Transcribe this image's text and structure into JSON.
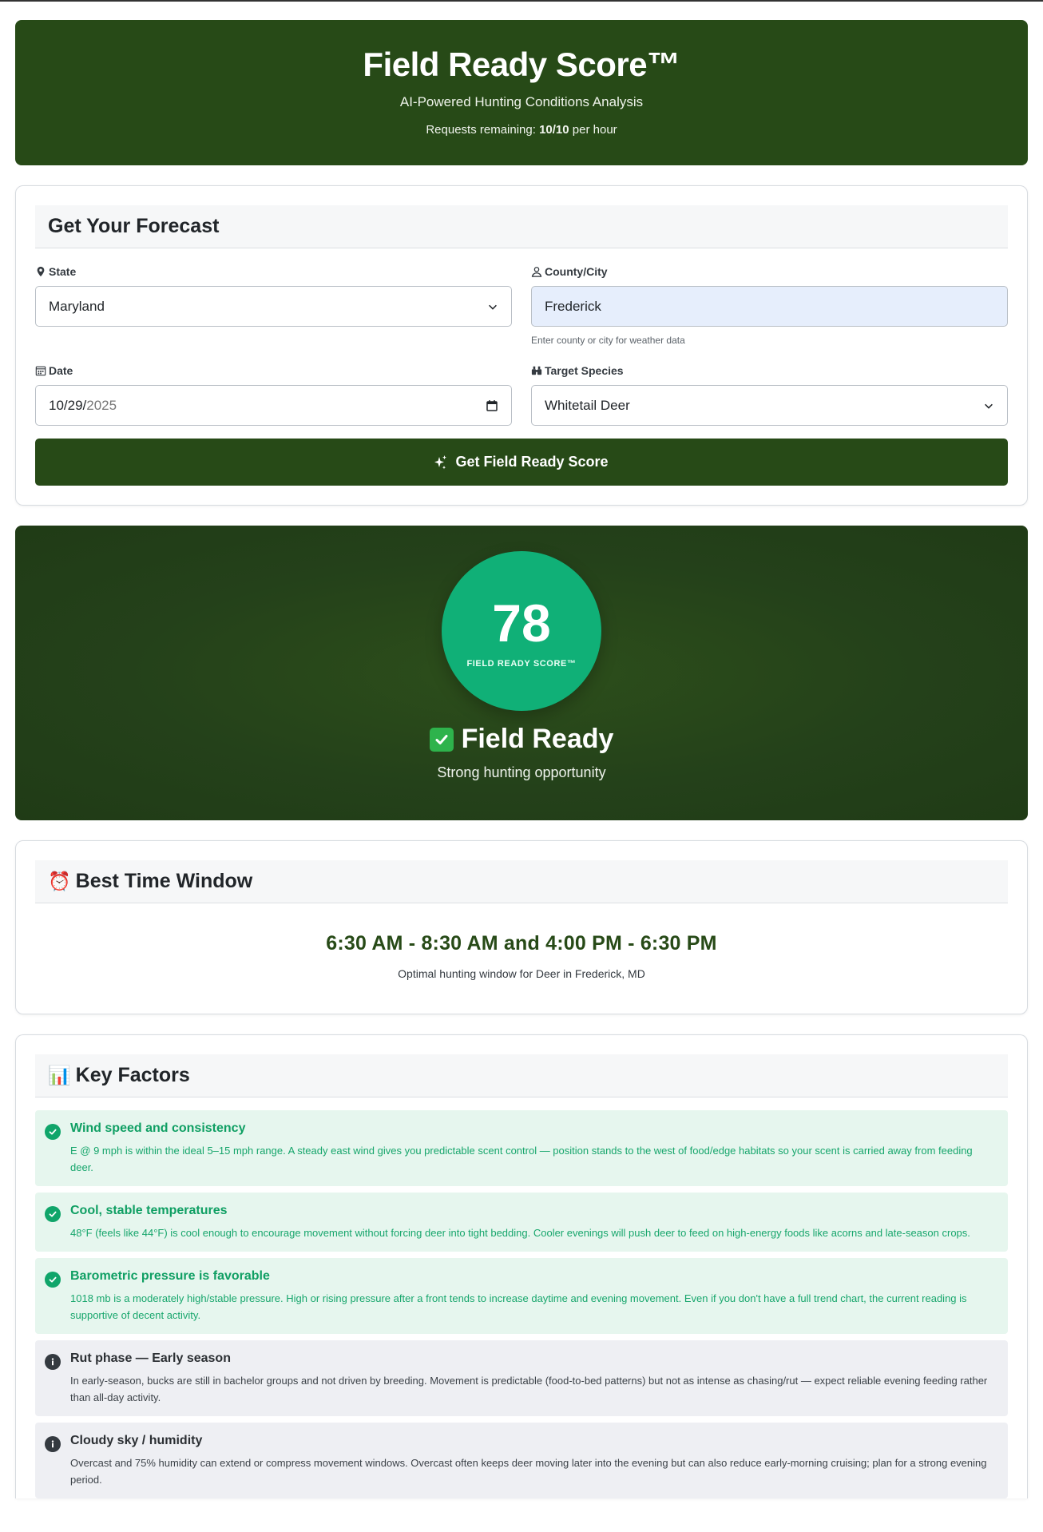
{
  "header": {
    "title": "Field Ready Score™",
    "subtitle": "AI-Powered Hunting Conditions Analysis",
    "requests_prefix": "Requests remaining: ",
    "requests_value": "10/10",
    "requests_suffix": " per hour"
  },
  "form": {
    "heading": "Get Your Forecast",
    "state_label": "State",
    "state_value": "Maryland",
    "county_label": "County/City",
    "county_value": "Frederick",
    "county_help": "Enter county or city for weather data",
    "date_label": "Date",
    "date_month_day": "10/29/",
    "date_year": "2025",
    "species_label": "Target Species",
    "species_value": "Whitetail Deer",
    "submit_label": "Get Field Ready Score"
  },
  "score": {
    "value": "78",
    "label": "FIELD READY SCORE™",
    "verdict": "Field Ready",
    "verdict_sub": "Strong hunting opportunity",
    "accent_color": "#10b077"
  },
  "best_time": {
    "emoji": "⏰",
    "heading": "Best Time Window",
    "window": "6:30 AM - 8:30 AM and 4:00 PM - 6:30 PM",
    "caption": "Optimal hunting window for Deer in Frederick, MD"
  },
  "key_factors": {
    "emoji": "📊",
    "heading": "Key Factors",
    "items": [
      {
        "status": "good",
        "title": "Wind speed and consistency",
        "desc": "E @ 9 mph is within the ideal 5–15 mph range. A steady east wind gives you predictable scent control — position stands to the west of food/edge habitats so your scent is carried away from feeding deer."
      },
      {
        "status": "good",
        "title": "Cool, stable temperatures",
        "desc": "48°F (feels like 44°F) is cool enough to encourage movement without forcing deer into tight bedding. Cooler evenings will push deer to feed on high-energy foods like acorns and late-season crops."
      },
      {
        "status": "good",
        "title": "Barometric pressure is favorable",
        "desc": "1018 mb is a moderately high/stable pressure. High or rising pressure after a front tends to increase daytime and evening movement. Even if you don't have a full trend chart, the current reading is supportive of decent activity."
      },
      {
        "status": "info",
        "title": "Rut phase — Early season",
        "desc": "In early-season, bucks are still in bachelor groups and not driven by breeding. Movement is predictable (food-to-bed patterns) but not as intense as chasing/rut — expect reliable evening feeding rather than all-day activity."
      },
      {
        "status": "info",
        "title": "Cloudy sky / humidity",
        "desc": "Overcast and 75% humidity can extend or compress movement windows. Overcast often keeps deer moving later into the evening but can also reduce early-morning cruising; plan for a strong evening period."
      }
    ]
  }
}
